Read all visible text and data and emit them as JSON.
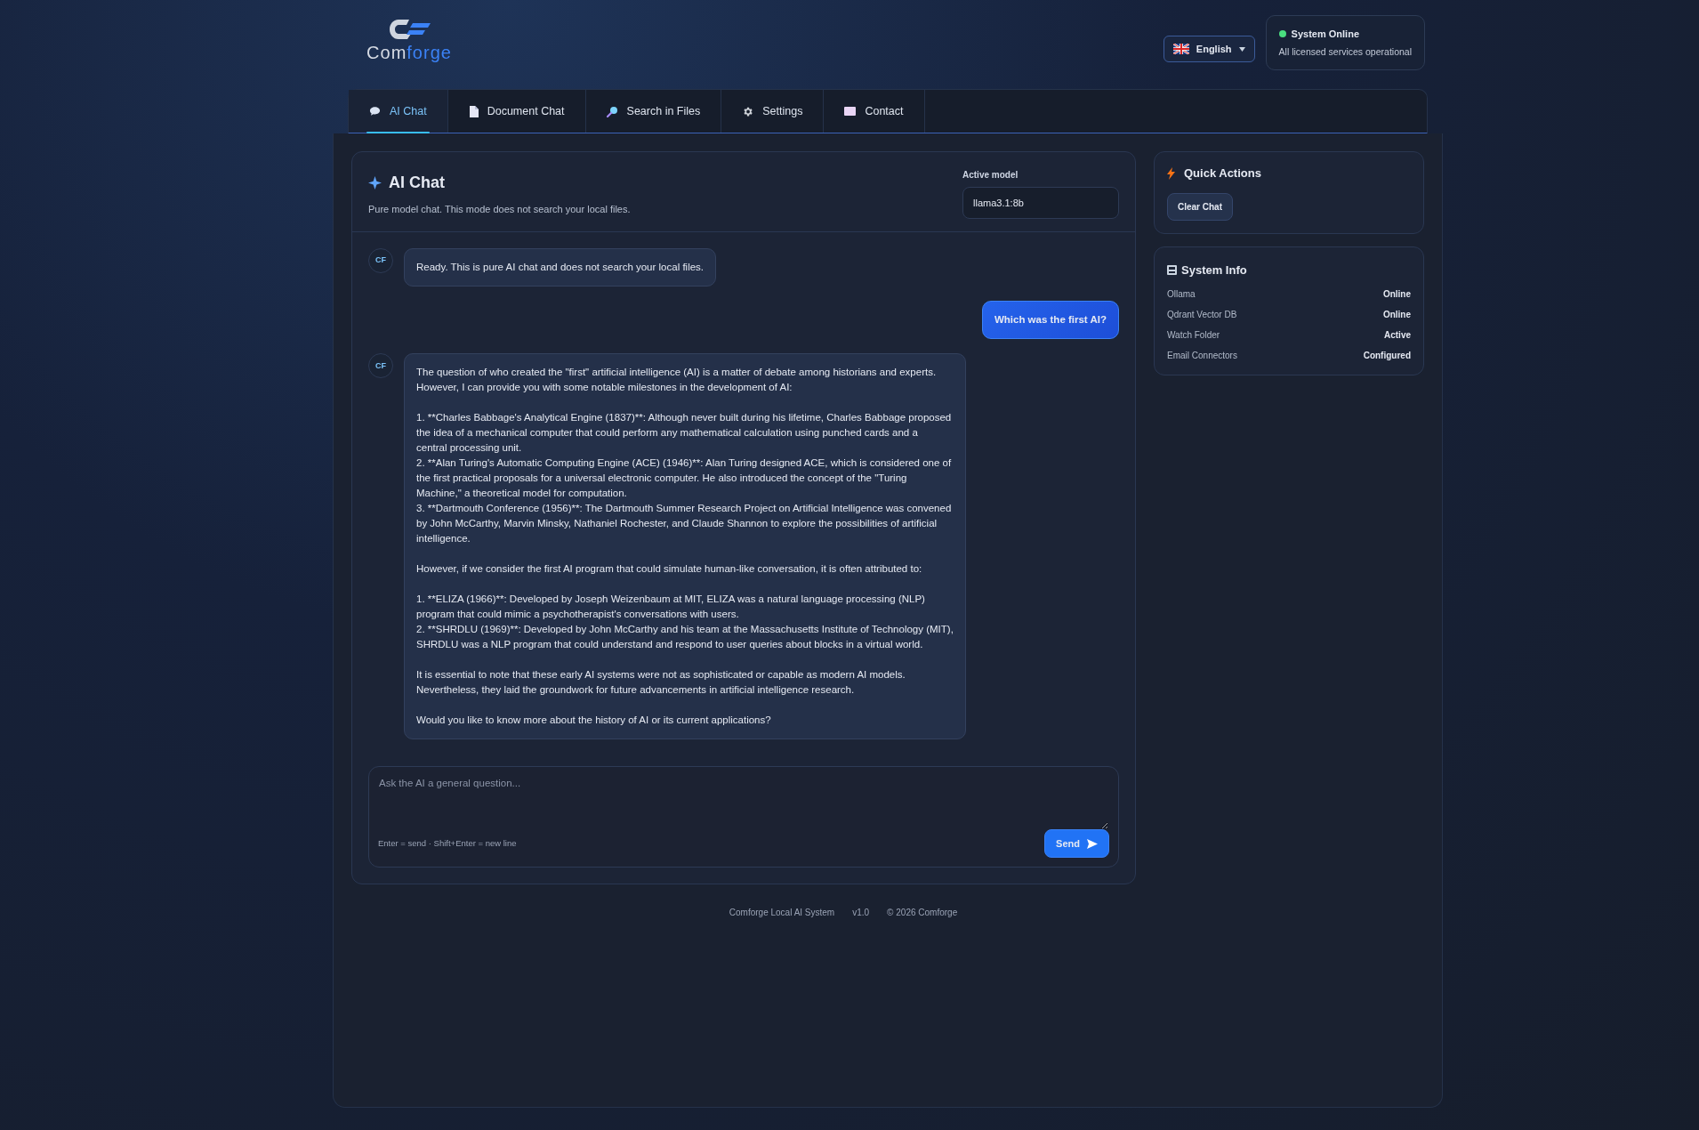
{
  "logo": {
    "text_main": "Com",
    "text_accent": "forge"
  },
  "language": {
    "label": "English"
  },
  "status": {
    "title": "System Online",
    "subtitle": "All licensed services operational",
    "online": true
  },
  "tabs": [
    {
      "label": "AI Chat",
      "kind": "chat",
      "selected": true
    },
    {
      "label": "Document Chat",
      "kind": "document",
      "selected": false
    },
    {
      "label": "Search in Files",
      "kind": "search",
      "selected": false
    },
    {
      "label": "Settings",
      "kind": "settings",
      "selected": false
    },
    {
      "label": "Contact",
      "kind": "mail",
      "selected": false
    }
  ],
  "chat": {
    "title": "AI Chat",
    "subtitle": "Pure model chat. This mode does not search your local files.",
    "model_label": "Active model",
    "model_value": "llama3.1:8b",
    "messages": [
      {
        "kind": "assistant",
        "avatar": "CF",
        "paragraphs": [
          [
            "Ready. This is pure AI chat and does not search your local files."
          ]
        ]
      },
      {
        "kind": "user",
        "paragraphs": [
          [
            "Which was the first AI?"
          ]
        ]
      },
      {
        "kind": "assistant",
        "avatar": "CF",
        "paragraphs": [
          [
            "The question of who created the \"first\" artificial intelligence (AI) is a matter of debate among historians and experts.",
            "However, I can provide you with some notable milestones in the development of AI:"
          ],
          [
            "1. **Charles Babbage's Analytical Engine (1837)**: Although never built during his lifetime, Charles Babbage proposed",
            "the idea of a mechanical computer that could perform any mathematical calculation using punched cards and a",
            "central processing unit.",
            "2. **Alan Turing's Automatic Computing Engine (ACE) (1946)**: Alan Turing designed ACE, which is considered one of",
            "the first practical proposals for a universal electronic computer. He also introduced the concept of the \"Turing",
            "Machine,\" a theoretical model for computation.",
            "3. **Dartmouth Conference (1956)**: The Dartmouth Summer Research Project on Artificial Intelligence was convened",
            "by John McCarthy, Marvin Minsky, Nathaniel Rochester, and Claude Shannon to explore the possibilities of artificial",
            "intelligence."
          ],
          [
            "However, if we consider the first AI program that could simulate human-like conversation, it is often attributed to:"
          ],
          [
            "1. **ELIZA (1966)**: Developed by Joseph Weizenbaum at MIT, ELIZA was a natural language processing (NLP)",
            "program that could mimic a psychotherapist's conversations with users.",
            "2. **SHRDLU (1969)**: Developed by John McCarthy and his team at the Massachusetts Institute of Technology (MIT),",
            "SHRDLU was a NLP program that could understand and respond to user queries about blocks in a virtual world."
          ],
          [
            "It is essential to note that these early AI systems were not as sophisticated or capable as modern AI models.",
            "Nevertheless, they laid the groundwork for future advancements in artificial intelligence research."
          ],
          [
            "Would you like to know more about the history of AI or its current applications?"
          ]
        ]
      }
    ],
    "input": {
      "placeholder": "Ask the AI a general question...",
      "hint": "Enter = send · Shift+Enter = new line",
      "send_label": "Send"
    }
  },
  "quick_actions": {
    "title": "Quick Actions",
    "buttons": [
      "Clear Chat"
    ]
  },
  "system_info": {
    "title": "System Info",
    "rows": [
      {
        "label": "Ollama",
        "value": "Online"
      },
      {
        "label": "Qdrant Vector DB",
        "value": "Online"
      },
      {
        "label": "Watch Folder",
        "value": "Active"
      },
      {
        "label": "Email Connectors",
        "value": "Configured"
      }
    ]
  },
  "footer": [
    "Comforge Local AI System",
    "v1.0",
    "© 2026 Comforge"
  ]
}
